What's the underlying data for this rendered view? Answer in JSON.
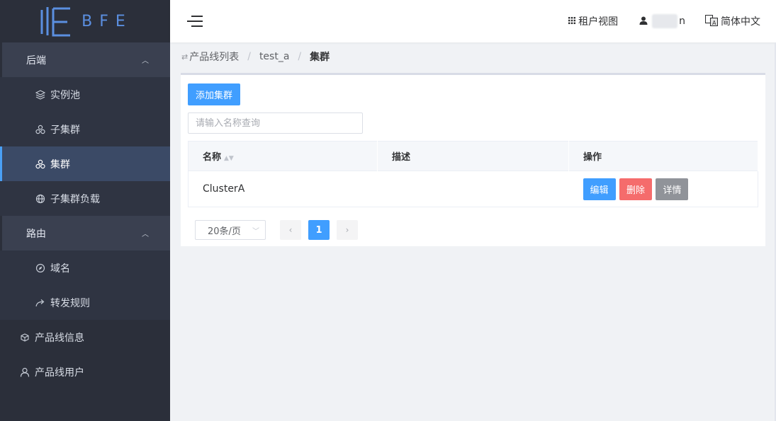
{
  "sidebar": {
    "logo_text": "BFE",
    "groups": [
      {
        "title": "后端",
        "items": [
          {
            "label": "实例池",
            "icon": "layers-icon"
          },
          {
            "label": "子集群",
            "icon": "cluster-icon"
          },
          {
            "label": "集群",
            "icon": "cluster-icon",
            "active": true
          },
          {
            "label": "子集群负载",
            "icon": "globe-icon"
          }
        ]
      },
      {
        "title": "路由",
        "items": [
          {
            "label": "域名",
            "icon": "compass-icon"
          },
          {
            "label": "转发规则",
            "icon": "forward-icon"
          }
        ]
      }
    ],
    "top_items": [
      {
        "label": "产品线信息",
        "icon": "cube-icon"
      },
      {
        "label": "产品线用户",
        "icon": "user-icon"
      }
    ]
  },
  "header": {
    "tenant_view": "租户视图",
    "username_suffix": "n",
    "language": "简体中文"
  },
  "breadcrumb": {
    "items": [
      "产品线列表",
      "test_a",
      "集群"
    ]
  },
  "main": {
    "add_button": "添加集群",
    "search_placeholder": "请输入名称查询",
    "table": {
      "columns": [
        "名称",
        "描述",
        "操作"
      ],
      "rows": [
        {
          "name": "ClusterA",
          "desc": ""
        }
      ],
      "actions": [
        "编辑",
        "删除",
        "详情"
      ]
    },
    "pagination": {
      "page_size": "20条/页",
      "current_page": "1"
    }
  },
  "colors": {
    "sidebar_bg": "#2b2f3a",
    "primary": "#409eff",
    "danger": "#f56c6c",
    "info": "#909399"
  }
}
